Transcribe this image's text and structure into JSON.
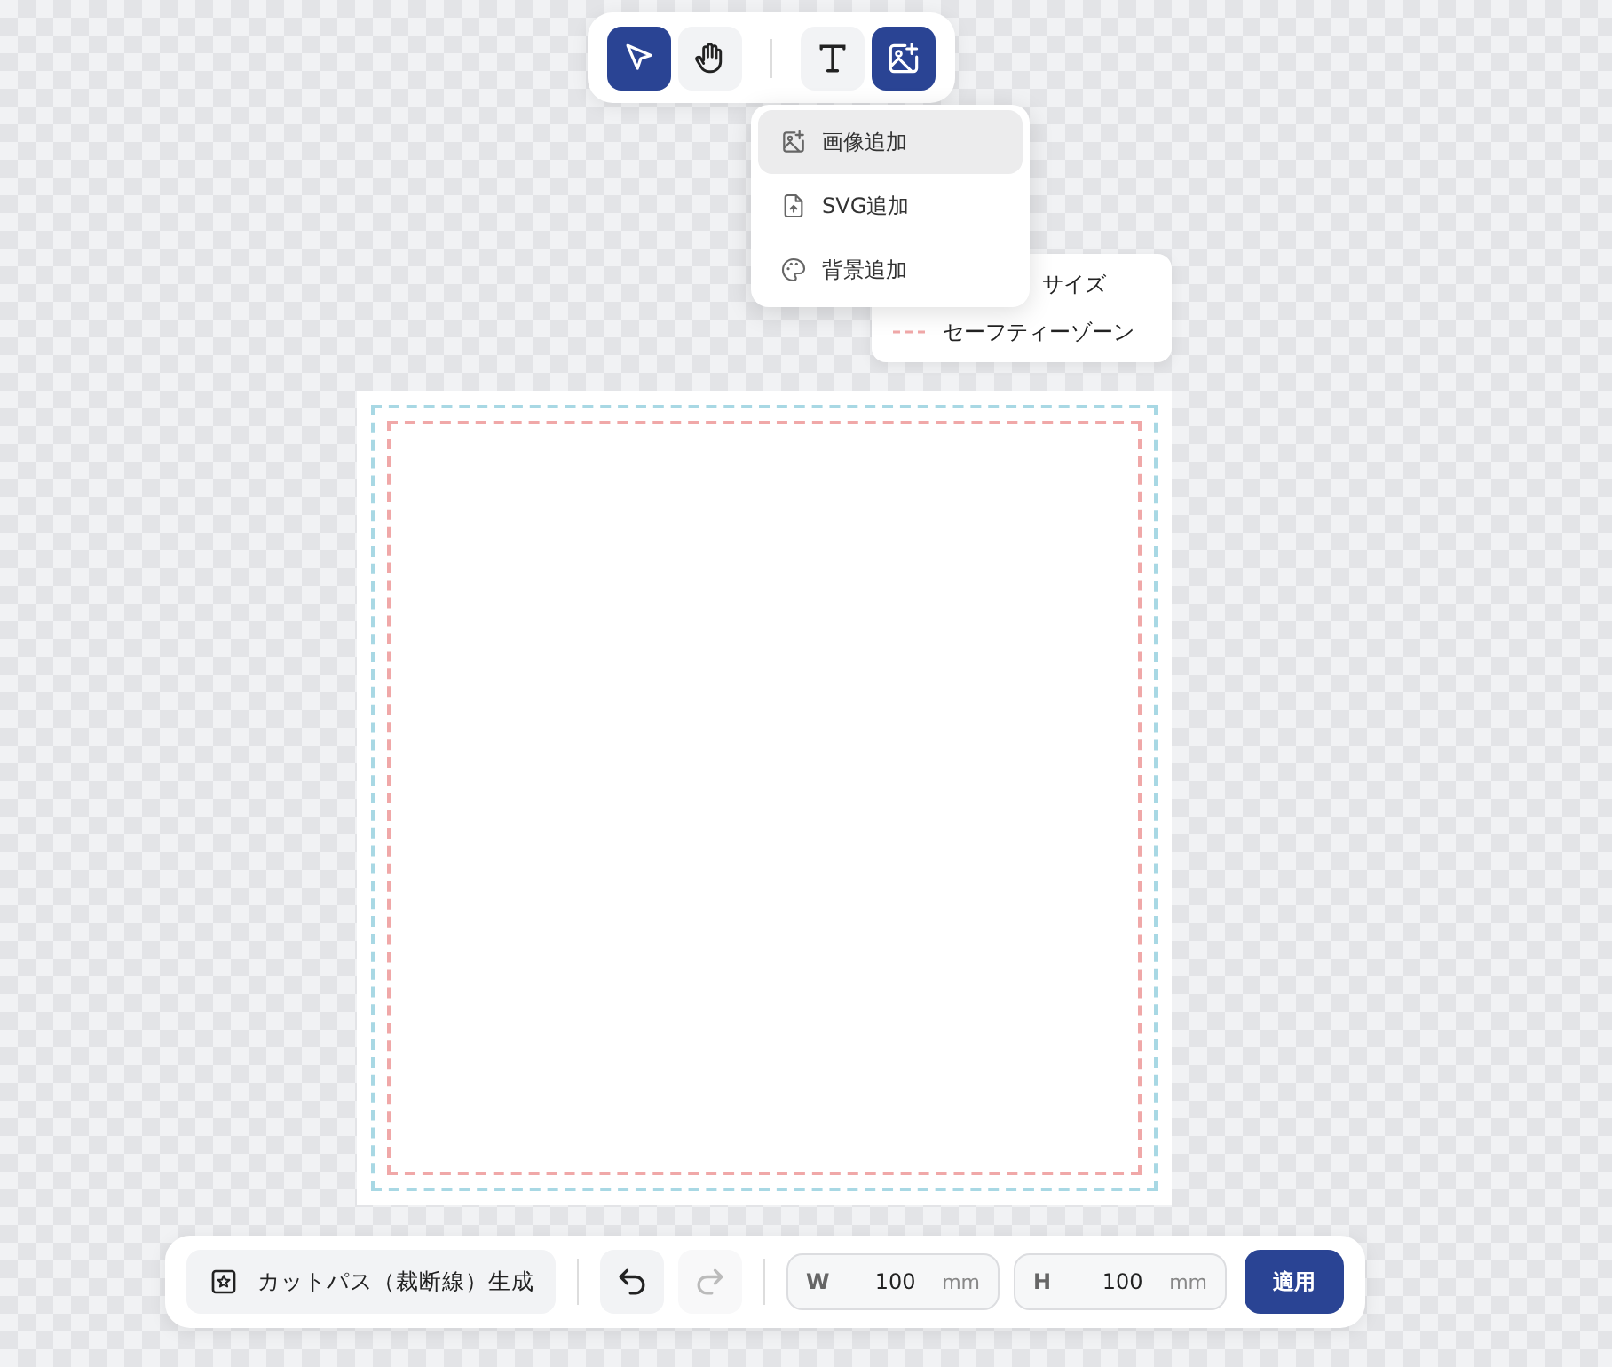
{
  "toolbar": {
    "groups": [
      {
        "tools": [
          {
            "kind": "pointer",
            "selected": true
          },
          {
            "kind": "hand",
            "selected": false
          }
        ]
      },
      {
        "tools": [
          {
            "kind": "text",
            "selected": false
          },
          {
            "kind": "image",
            "selected": true
          }
        ]
      }
    ]
  },
  "add_menu": {
    "items": [
      {
        "kind": "image",
        "label": "画像追加",
        "selected": true
      },
      {
        "kind": "svg",
        "label": "SVG追加",
        "selected": false
      },
      {
        "kind": "background",
        "label": "背景追加",
        "selected": false
      }
    ]
  },
  "legend": {
    "items": [
      {
        "label": "サイズ"
      },
      {
        "label": "セーフティーゾーン",
        "color": "#f0a8a8"
      }
    ]
  },
  "canvas": {
    "guides": [
      {
        "color": "#a8d8e4"
      },
      {
        "color": "#f0a8a8"
      }
    ]
  },
  "bottom_bar": {
    "cut_path_button": "カットパス（裁断線）生成",
    "undo": {
      "disabled": false
    },
    "redo": {
      "disabled": true
    },
    "fields": [
      {
        "label": "W",
        "value": "100",
        "unit": "mm"
      },
      {
        "label": "H",
        "value": "100",
        "unit": "mm"
      }
    ],
    "apply_button": "適用"
  }
}
